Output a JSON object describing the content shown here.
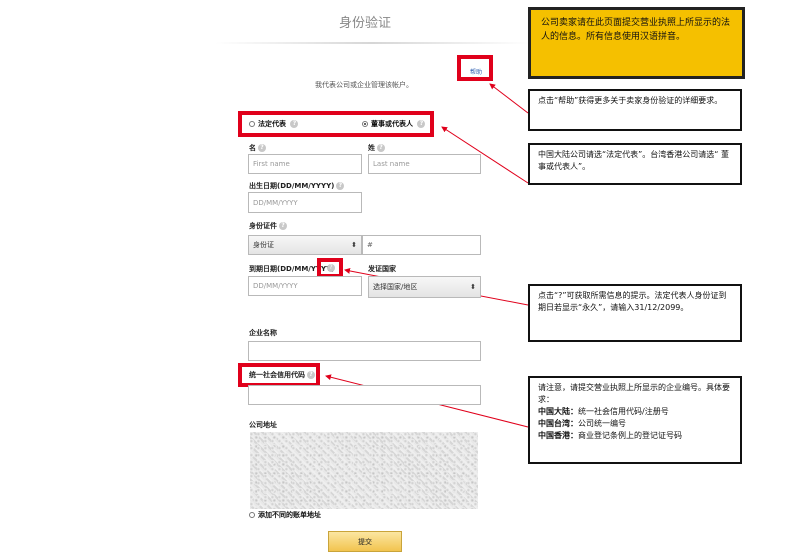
{
  "page": {
    "title": "身份验证",
    "subtitle": "我代表公司或企业管理该帐户。",
    "help_link": "帮助",
    "question_glyph": "?"
  },
  "representative": {
    "option_legal": "法定代表",
    "option_director": "董事或代表人",
    "selected": "option_director"
  },
  "form": {
    "first_name_label": "名",
    "first_name_placeholder": "First name",
    "last_name_label": "姓",
    "last_name_placeholder": "Last name",
    "dob_label": "出生日期(DD/MM/YYYY)",
    "dob_placeholder": "DD/MM/YYYY",
    "id_label": "身份证件",
    "id_type_value": "身份证",
    "id_number_hash": "#",
    "expiry_label": "到期日期(DD/MM/YYYY)",
    "expiry_placeholder": "DD/MM/YYYY",
    "country_label": "发证国家",
    "country_value": "选择国家/地区",
    "company_name_label": "企业名称",
    "credit_code_label": "统一社会信用代码",
    "address_label": "公司地址",
    "add_billing_address": "添加不同的账单地址",
    "submit": "提交"
  },
  "callouts": {
    "yellow": "公司卖家请在此页面提交营业执照上所显示的法人的信息。所有信息使用汉语拼音。",
    "help": "点击“帮助”获得更多关于卖家身份验证的详细要求。",
    "representative": "中国大陆公司请选“法定代表”。台湾香港公司请选“ 董事或代表人”。",
    "expiry": "点击“?”可获取所需信息的提示。法定代表人身份证到期日若显示“永久”，请输入31/12/2099。",
    "code_intro": "请注意，请提交营业执照上所显示的企业编号。具体要求：",
    "code_mainland_label": "中国大陆：",
    "code_mainland_value": "统一社会信用代码/注册号",
    "code_taiwan_label": "中国台湾：",
    "code_taiwan_value": "公司统一编号",
    "code_hongkong_label": "中国香港：",
    "code_hongkong_value": "商业登记条例上的登记证号码"
  },
  "colors": {
    "annotation_red": "#e0001b",
    "callout_yellow": "#f5c000",
    "submit_gold": "#f2c44f"
  }
}
